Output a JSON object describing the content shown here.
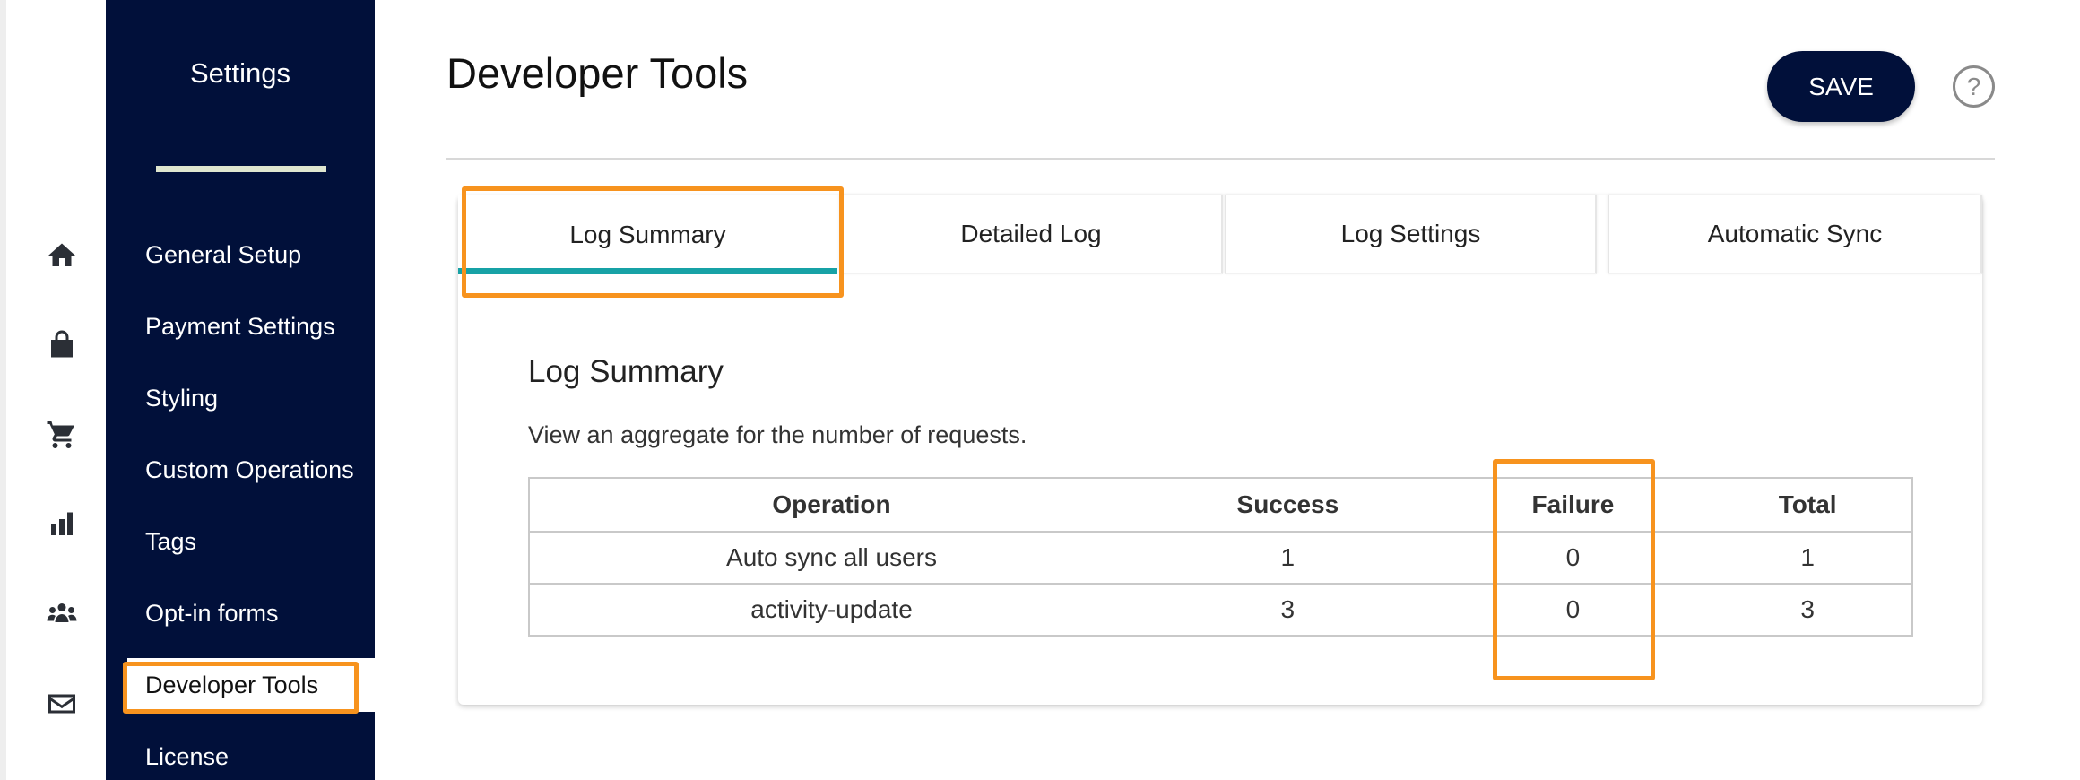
{
  "sidebar": {
    "title": "Settings",
    "items": [
      {
        "label": "General Setup"
      },
      {
        "label": "Payment Settings"
      },
      {
        "label": "Styling"
      },
      {
        "label": "Custom Operations"
      },
      {
        "label": "Tags"
      },
      {
        "label": "Opt-in forms"
      },
      {
        "label": "Developer Tools",
        "active": true
      },
      {
        "label": "License"
      }
    ]
  },
  "icon_rail": [
    "home-icon",
    "store-icon",
    "cart-icon",
    "bar-chart-icon",
    "people-icon",
    "mail-icon"
  ],
  "header": {
    "title": "Developer Tools",
    "save_label": "SAVE",
    "help_label": "?"
  },
  "tabs": [
    {
      "label": "Log Summary",
      "active": true
    },
    {
      "label": "Detailed Log"
    },
    {
      "label": "Log Settings"
    },
    {
      "label": "Automatic Sync"
    }
  ],
  "summary": {
    "title": "Log Summary",
    "description": "View an aggregate for the number of requests.",
    "columns": [
      "Operation",
      "Success",
      "Failure",
      "Total"
    ],
    "rows": [
      [
        "Auto sync all users",
        "1",
        "0",
        "1"
      ],
      [
        "activity-update",
        "3",
        "0",
        "3"
      ]
    ]
  },
  "colors": {
    "sidebar_bg": "#01103a",
    "accent_teal": "#17a2a6",
    "highlight_orange": "#f7931e"
  }
}
